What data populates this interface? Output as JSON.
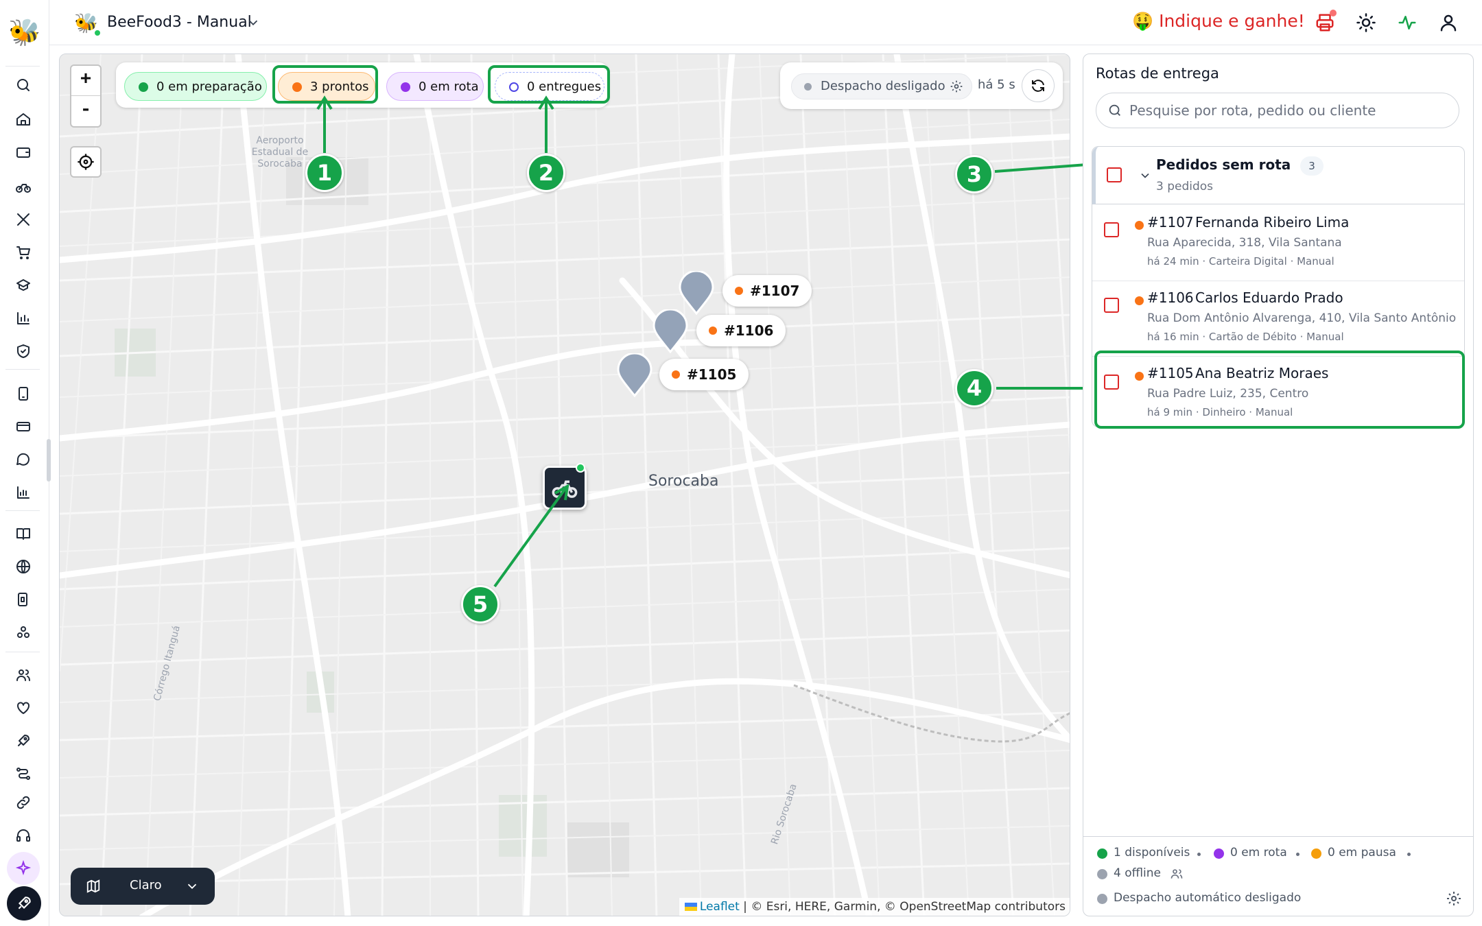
{
  "app": {
    "store_name": "BeeFood3 - Manual",
    "referral_text": "🤑 Indique e ganhe!"
  },
  "sidebar": {
    "items": [
      "search-icon",
      "home-icon",
      "wallet-icon",
      "bike-icon",
      "utensils-icon",
      "cart-icon",
      "box-icon",
      "bar-chart-icon",
      "shield-icon",
      "tablet-icon",
      "card-icon",
      "chat-icon",
      "stats-icon",
      "book-icon",
      "globe-icon",
      "devices-icon",
      "integrations-icon",
      "users-icon",
      "heart-icon",
      "rocket-icon",
      "route-icon",
      "link-icon",
      "headset-icon",
      "sparkles-icon",
      "launch-icon"
    ]
  },
  "map": {
    "zoom_in": "+",
    "zoom_out": "-",
    "filters": [
      {
        "label": "0 em preparação",
        "color": "#16a34a"
      },
      {
        "label": "3 prontos",
        "color": "#f97316"
      },
      {
        "label": "0 em rota",
        "color": "#9333ea"
      },
      {
        "label": "0 entregues",
        "color": "#4f46e5"
      }
    ],
    "dispatch_label": "Despacho desligado",
    "updated_ago": "há 5 s",
    "pins": [
      {
        "label": "#1107"
      },
      {
        "label": "#1106"
      },
      {
        "label": "#1105"
      }
    ],
    "city": "Sorocaba",
    "airport_label": [
      "Aeroporto",
      "Estadual de",
      "Sorocaba"
    ],
    "road_labels": [
      "Córrego Itanguá",
      "Rio Sorocaba"
    ],
    "style_picker": "Claro",
    "attribution_link": "Leaflet",
    "attribution_text": " | © Esri, HERE, Garmin, © OpenStreetMap contributors"
  },
  "annotations": [
    "1",
    "2",
    "3",
    "4",
    "5"
  ],
  "panel": {
    "title": "Rotas de entrega",
    "search_placeholder": "Pesquise por rota, pedido ou cliente",
    "group": {
      "title": "Pedidos sem rota",
      "count": "3",
      "subtitle": "3 pedidos"
    },
    "orders": [
      {
        "id": "#1107",
        "name": "Fernanda Ribeiro Lima",
        "address": "Rua Aparecida, 318, Vila Santana",
        "meta": "há 24 min · Carteira Digital · Manual"
      },
      {
        "id": "#1106",
        "name": "Carlos Eduardo Prado",
        "address": "Rua Dom Antônio Alvarenga, 410, Vila Santo Antônio",
        "meta": "há 16 min · Cartão de Débito · Manual"
      },
      {
        "id": "#1105",
        "name": "Ana Beatriz Moraes",
        "address": "Rua Padre Luiz, 235, Centro",
        "meta": "há 9 min · Dinheiro · Manual"
      }
    ],
    "footer": {
      "available": "1 disponíveis",
      "on_route": "0 em rota",
      "paused": "0 em pausa",
      "offline": "4 offline",
      "auto_dispatch": "Despacho automático desligado"
    }
  },
  "colors": {
    "annotation_green": "#16a34a",
    "ready_orange": "#f97316",
    "checkbox_red": "#dc2626"
  }
}
